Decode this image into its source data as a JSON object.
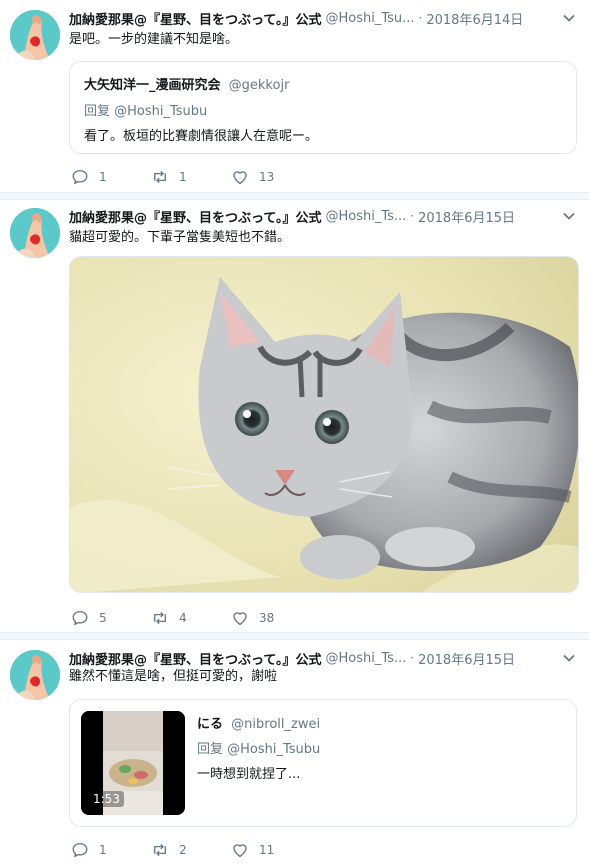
{
  "tweets": [
    {
      "name": "加納愛那果@『星野、目をつぶって。』公式",
      "handle": "@Hoshi_Tsu...",
      "dot": "·",
      "time": "2018年6月14日",
      "text": "是吧。一步的建議不知是啥。",
      "quote": {
        "name": "大矢知洋一_漫画研究会",
        "handle": "@gekkojr",
        "reply": "回复 @Hoshi_Tsubu",
        "text": "看了。板垣的比賽劇情很讓人在意呢ー。"
      },
      "actions": {
        "replies": "1",
        "retweets": "1",
        "likes": "13"
      }
    },
    {
      "name": "加納愛那果@『星野、目をつぶって。』公式",
      "handle": "@Hoshi_Ts...",
      "dot": "·",
      "time": "2018年6月15日",
      "text": "貓超可愛的。下輩子當隻美短也不錯。",
      "actions": {
        "replies": "5",
        "retweets": "4",
        "likes": "38"
      }
    },
    {
      "name": "加納愛那果@『星野、目をつぶって。』公式",
      "handle": "@Hoshi_Ts...",
      "dot": "·",
      "time": "2018年6月15日",
      "text": "雖然不懂這是啥，但挺可愛的，謝啦",
      "quote": {
        "name": "にる",
        "handle": "@nibroll_zwei",
        "reply": "回复 @Hoshi_Tsubu",
        "text": "一時想到就捏了...",
        "video_duration": "1:53"
      },
      "actions": {
        "replies": "1",
        "retweets": "2",
        "likes": "11"
      }
    }
  ],
  "colors": {
    "text": "#14171a",
    "secondary": "#657786",
    "border": "#e1e8ed",
    "avatar_bg": "#5cc8c9"
  }
}
